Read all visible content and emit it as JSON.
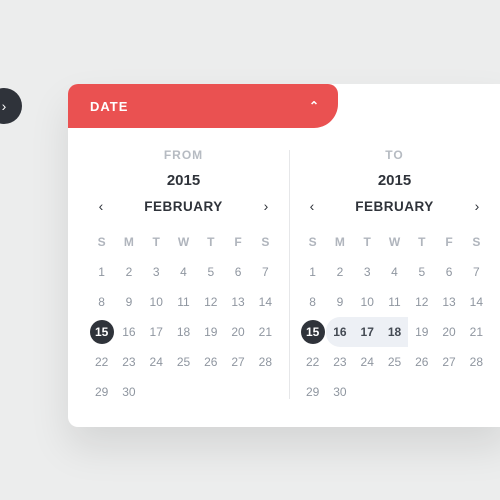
{
  "circle_button_glyph": "›",
  "tab": {
    "label": "DATE",
    "caret": "⌃"
  },
  "dow": [
    "S",
    "M",
    "T",
    "W",
    "T",
    "F",
    "S"
  ],
  "from": {
    "label": "FROM",
    "year": "2015",
    "month": "FEBRUARY",
    "days": [
      1,
      2,
      3,
      4,
      5,
      6,
      7,
      8,
      9,
      10,
      11,
      12,
      13,
      14,
      15,
      16,
      17,
      18,
      19,
      20,
      21,
      22,
      23,
      24,
      25,
      26,
      27,
      28,
      29,
      30
    ],
    "selected_start": 15
  },
  "to": {
    "label": "TO",
    "year": "2015",
    "month": "FEBRUARY",
    "days": [
      1,
      2,
      3,
      4,
      5,
      6,
      7,
      8,
      9,
      10,
      11,
      12,
      13,
      14,
      15,
      16,
      17,
      18,
      19,
      20,
      21,
      22,
      23,
      24,
      25,
      26,
      27,
      28,
      29,
      30
    ],
    "selected_start": 15,
    "range": [
      16,
      17,
      18
    ]
  }
}
